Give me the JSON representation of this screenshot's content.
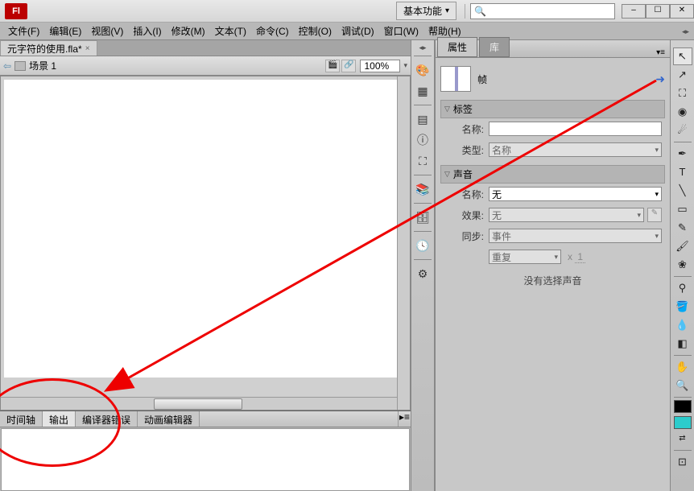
{
  "app": {
    "logo_text": "Fl"
  },
  "workspace": {
    "label": "基本功能"
  },
  "search": {
    "placeholder": ""
  },
  "menu": {
    "file": "文件(F)",
    "edit": "编辑(E)",
    "view": "视图(V)",
    "insert": "插入(I)",
    "modify": "修改(M)",
    "text": "文本(T)",
    "commands": "命令(C)",
    "control": "控制(O)",
    "debug": "调试(D)",
    "window": "窗口(W)",
    "help": "帮助(H)"
  },
  "doc_tab": {
    "name": "元字符的使用.fla*",
    "close": "×"
  },
  "scene": {
    "name": "场景 1",
    "zoom": "100%"
  },
  "bottom_tabs": {
    "timeline": "时间轴",
    "output": "输出",
    "compiler": "编译器错误",
    "anim": "动画编辑器"
  },
  "panel_tabs": {
    "properties": "属性",
    "library": "库"
  },
  "frame": {
    "title": "帧"
  },
  "sections": {
    "label": "标签",
    "sound": "声音"
  },
  "fields": {
    "name_label": "名称:",
    "type_label": "类型:",
    "effect_label": "效果:",
    "sync_label": "同步:",
    "type_value": "名称",
    "sound_name_value": "无",
    "effect_value": "无",
    "sync_value": "事件",
    "repeat_value": "重复",
    "x_label": "x",
    "x_count": "1"
  },
  "no_sound": "没有选择声音",
  "win_btns": {
    "min": "–",
    "max": "☐",
    "close": "✕"
  }
}
